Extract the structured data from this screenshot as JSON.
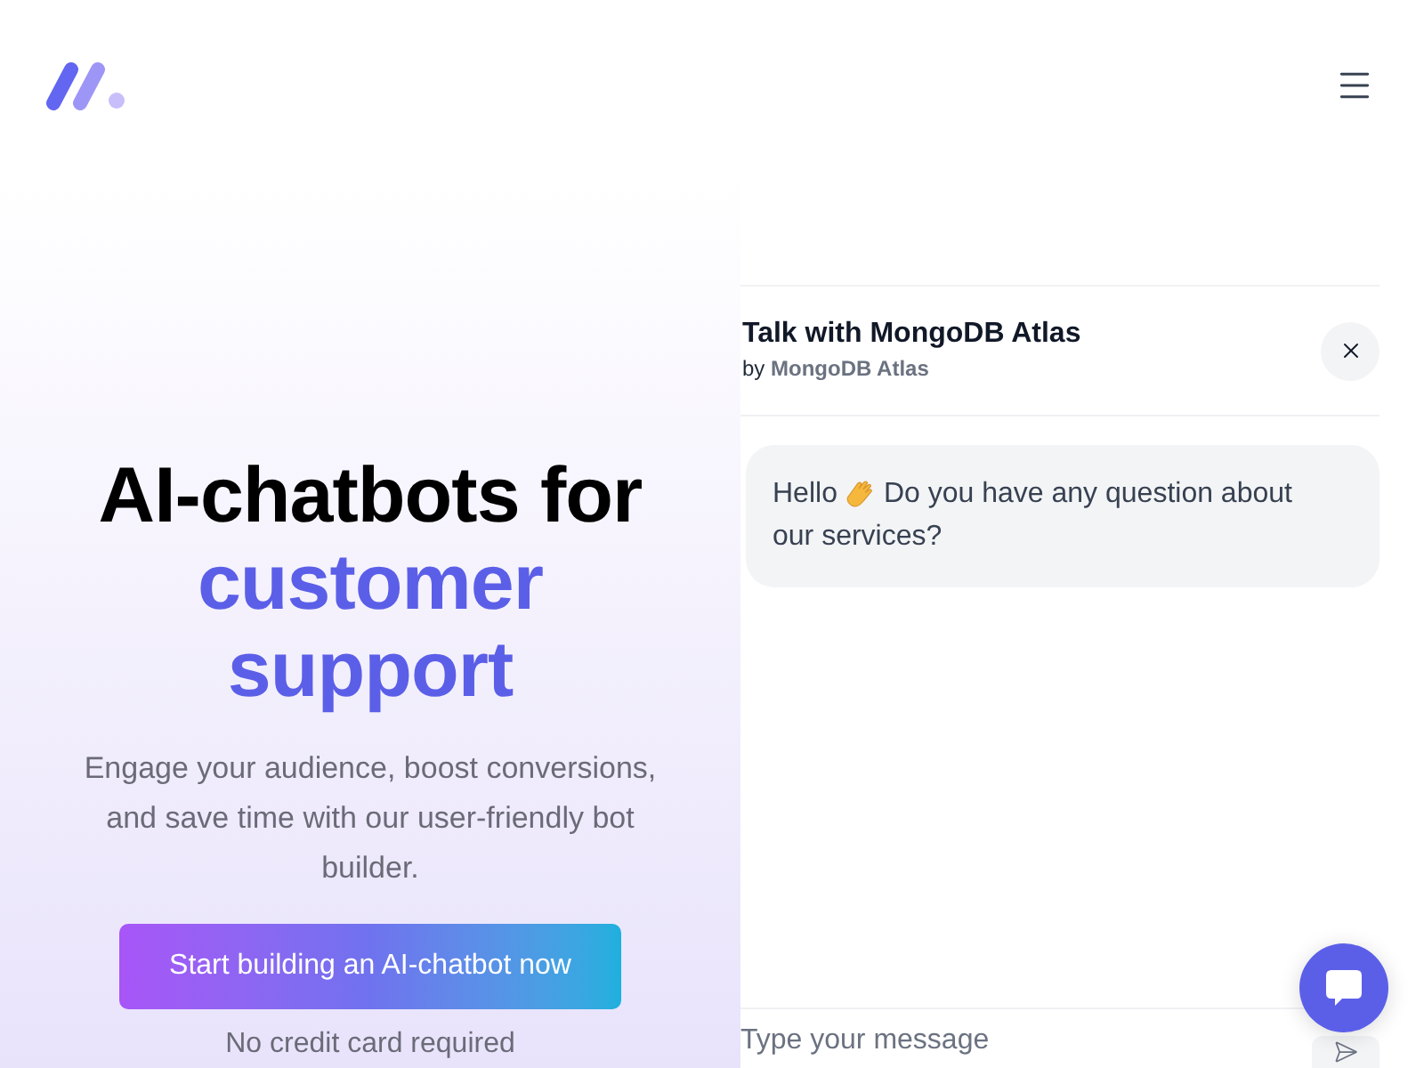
{
  "hero": {
    "headline": "AI-chatbots for",
    "headline_highlight": "customer support",
    "subtitle": "Engage your audience, boost conversions, and save time with our user-friendly bot builder.",
    "cta": "Start building an AI-chatbot now",
    "note": "No credit card required"
  },
  "chat": {
    "title": "Talk with MongoDB Atlas",
    "byline": "by **MongoDB Atlas**",
    "messages": [
      {
        "greeting": "Hello",
        "lines": [
          "Do you have any question about",
          "our services?"
        ]
      }
    ],
    "input": {
      "placeholder": "Type your message"
    }
  }
}
